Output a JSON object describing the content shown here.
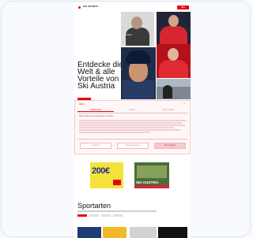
{
  "header": {
    "logo_text": "SKI SPORTS",
    "cta_label": "ABO"
  },
  "hero": {
    "title": "Entdecke die Welt & alle Vorteile von Ski Austria",
    "cta_label": "MEHR"
  },
  "tiles": [
    {
      "caption": "Ski Alpin"
    },
    {
      "caption": ""
    },
    {
      "caption": ""
    },
    {
      "caption": ""
    },
    {
      "caption": ""
    }
  ],
  "consent": {
    "tabs": [
      "Zustimmung",
      "Details",
      "Über Cookies"
    ],
    "heading": "Diese Webseite verwendet Cookies",
    "buttons": [
      "Ablehnen",
      "Auswahl erlauben",
      "Alle zulassen"
    ]
  },
  "promos": {
    "promo1_value": "200€",
    "promo2_label": "SKI AUSTRIA"
  },
  "section": {
    "title": "Sportarten"
  },
  "colors": {
    "brand": "#e30613",
    "promo_yellow": "#f4e23b",
    "promo_blue": "#1f2c8f"
  }
}
